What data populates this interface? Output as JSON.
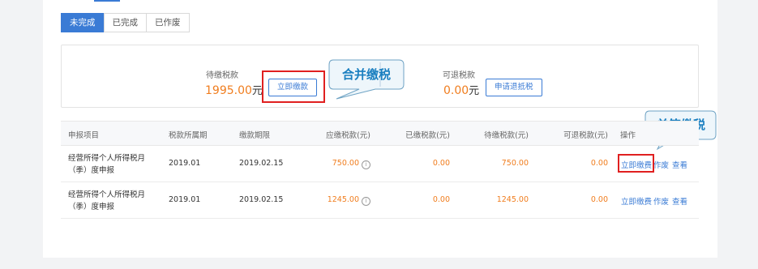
{
  "tabs": [
    {
      "label": "未完成",
      "active": true
    },
    {
      "label": "已完成",
      "active": false
    },
    {
      "label": "已作废",
      "active": false
    }
  ],
  "summary": {
    "pending_label": "待缴税款",
    "pending_amount": "1995.00",
    "pending_unit": "元",
    "pay_now_button": "立即缴款",
    "refundable_label": "可退税款",
    "refundable_amount": "0.00",
    "refundable_unit": "元",
    "refund_button": "申请退抵税"
  },
  "callouts": {
    "combined": "合并缴税",
    "single": "单笔缴税"
  },
  "table": {
    "headers": [
      "申报项目",
      "税款所属期",
      "缴款期限",
      "应缴税款(元)",
      "已缴税款(元)",
      "待缴税款(元)",
      "可退税款(元)",
      "操作"
    ],
    "rows": [
      {
        "item_line1": "经营所得个人所得税月",
        "item_line2": "（季）度申报",
        "period": "2019.01",
        "deadline": "2019.02.15",
        "due": "750.00",
        "paid": "0.00",
        "pending": "750.00",
        "refundable": "0.00",
        "action_pay": "立即缴费",
        "action_void": "作废",
        "action_view": "查看"
      },
      {
        "item_line1": "经营所得个人所得税月",
        "item_line2": "（季）度申报",
        "period": "2019.01",
        "deadline": "2019.02.15",
        "due": "1245.00",
        "paid": "0.00",
        "pending": "1245.00",
        "refundable": "0.00",
        "action_pay": "立即缴费",
        "action_void": "作废",
        "action_view": "查看"
      }
    ]
  },
  "colors": {
    "accent": "#3a7bd5",
    "amount": "#f07d1e",
    "highlight": "#e02020",
    "callout_text": "#1a7fc0"
  },
  "icons": {
    "info": "info-circle-icon"
  }
}
